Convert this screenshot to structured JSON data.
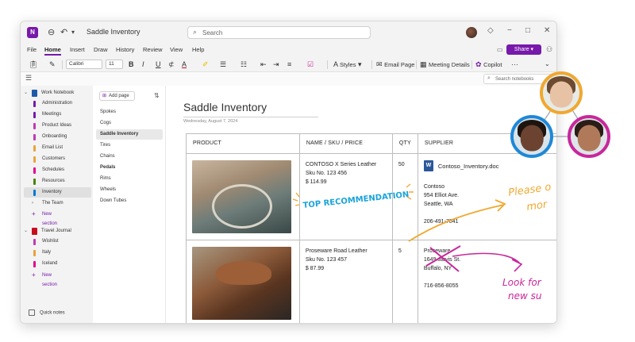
{
  "window": {
    "title": "Saddle Inventory",
    "search_placeholder": "Search",
    "app_icon_letter": "N",
    "controls": {
      "min": "−",
      "max": "□",
      "close": "✕"
    }
  },
  "menu": {
    "items": [
      "File",
      "Home",
      "Insert",
      "Draw",
      "History",
      "Review",
      "View",
      "Help"
    ],
    "active": "Home",
    "share_label": "Share"
  },
  "toolbar": {
    "font_family": "Calibri",
    "font_size": "11",
    "bold": "B",
    "italic": "I",
    "underline": "U",
    "font_color": "A",
    "styles_label": "Styles",
    "email_page_label": "Email Page",
    "meeting_details_label": "Meeting Details",
    "copilot_label": "Copilot",
    "more_label": "···"
  },
  "subbar": {
    "notebook_search_placeholder": "Search notebooks"
  },
  "sidebar": {
    "notebooks": [
      {
        "name": "Work Notebook",
        "color": "#1e5aa8",
        "sections": [
          {
            "label": "Administration",
            "color": "#7719aa"
          },
          {
            "label": "Meetings",
            "color": "#7719aa"
          },
          {
            "label": "Product Ideas",
            "color": "#c239b3"
          },
          {
            "label": "Onboarding",
            "color": "#c239b3"
          },
          {
            "label": "Email List",
            "color": "#e8a33a"
          },
          {
            "label": "Customers",
            "color": "#e8a33a"
          },
          {
            "label": "Schedules",
            "color": "#e3008c"
          },
          {
            "label": "Resources",
            "color": "#498205"
          },
          {
            "label": "Inventory",
            "color": "#0078d4",
            "selected": true
          },
          {
            "label": "The Team",
            "group": true
          }
        ]
      },
      {
        "name": "Travel Journal",
        "color": "#c50f1f",
        "sections": [
          {
            "label": "Wishlist",
            "color": "#c239b3"
          },
          {
            "label": "Italy",
            "color": "#e8a33a"
          },
          {
            "label": "Iceland",
            "color": "#e3008c"
          }
        ]
      }
    ],
    "new_section_label": "New section",
    "quick_notes_label": "Quick notes"
  },
  "pages": {
    "add_page_label": "Add page",
    "items": [
      {
        "label": "Spokes"
      },
      {
        "label": "Cogs"
      },
      {
        "label": "Saddle Inventory",
        "selected": true
      },
      {
        "label": "Tires"
      },
      {
        "label": "Chains"
      },
      {
        "label": "Pedals",
        "bold": true
      },
      {
        "label": "Rims"
      },
      {
        "label": "Wheels"
      },
      {
        "label": "Down Tubes"
      }
    ]
  },
  "page": {
    "title": "Saddle Inventory",
    "date": "Wednesday, August 7, 2024",
    "table": {
      "headers": [
        "PRODUCT",
        "NAME / SKU / PRICE",
        "QTY",
        "SUPPLIER"
      ],
      "rows": [
        {
          "name": "CONTOSO X Series Leather",
          "sku": "Sku No. 123 456",
          "price": "$ 114.99",
          "qty": "50",
          "attachment": "Contoso_Inventory.doc",
          "supplier_name": "Contoso",
          "supplier_address": "954 Elliot Ave.",
          "supplier_city": "Seattle, WA",
          "supplier_phone": "206-491-7041"
        },
        {
          "name": "Proseware Road Leather",
          "sku": "Sku No. 123 457",
          "price": "$ 87.99",
          "qty": "5",
          "supplier_name": "Proseware",
          "supplier_address": "1649 Jarvis St.",
          "supplier_city": "Buffalo, NY",
          "supplier_phone": "716-856-8055"
        }
      ]
    }
  },
  "ink": {
    "top_recommendation": "TOP RECOMMENDATION",
    "please_line1": "Please o",
    "please_line2": "mor",
    "look_for_line1": "Look for",
    "look_for_line2": "new su",
    "colors": {
      "blue": "#1aa3d9",
      "orange": "#f0a830",
      "magenta": "#c8279b"
    }
  },
  "collaborators": [
    {
      "name": "collaborator-1",
      "ring": "#f0a830"
    },
    {
      "name": "collaborator-2",
      "ring": "#1e88d8"
    },
    {
      "name": "collaborator-3",
      "ring": "#c8279b"
    }
  ]
}
